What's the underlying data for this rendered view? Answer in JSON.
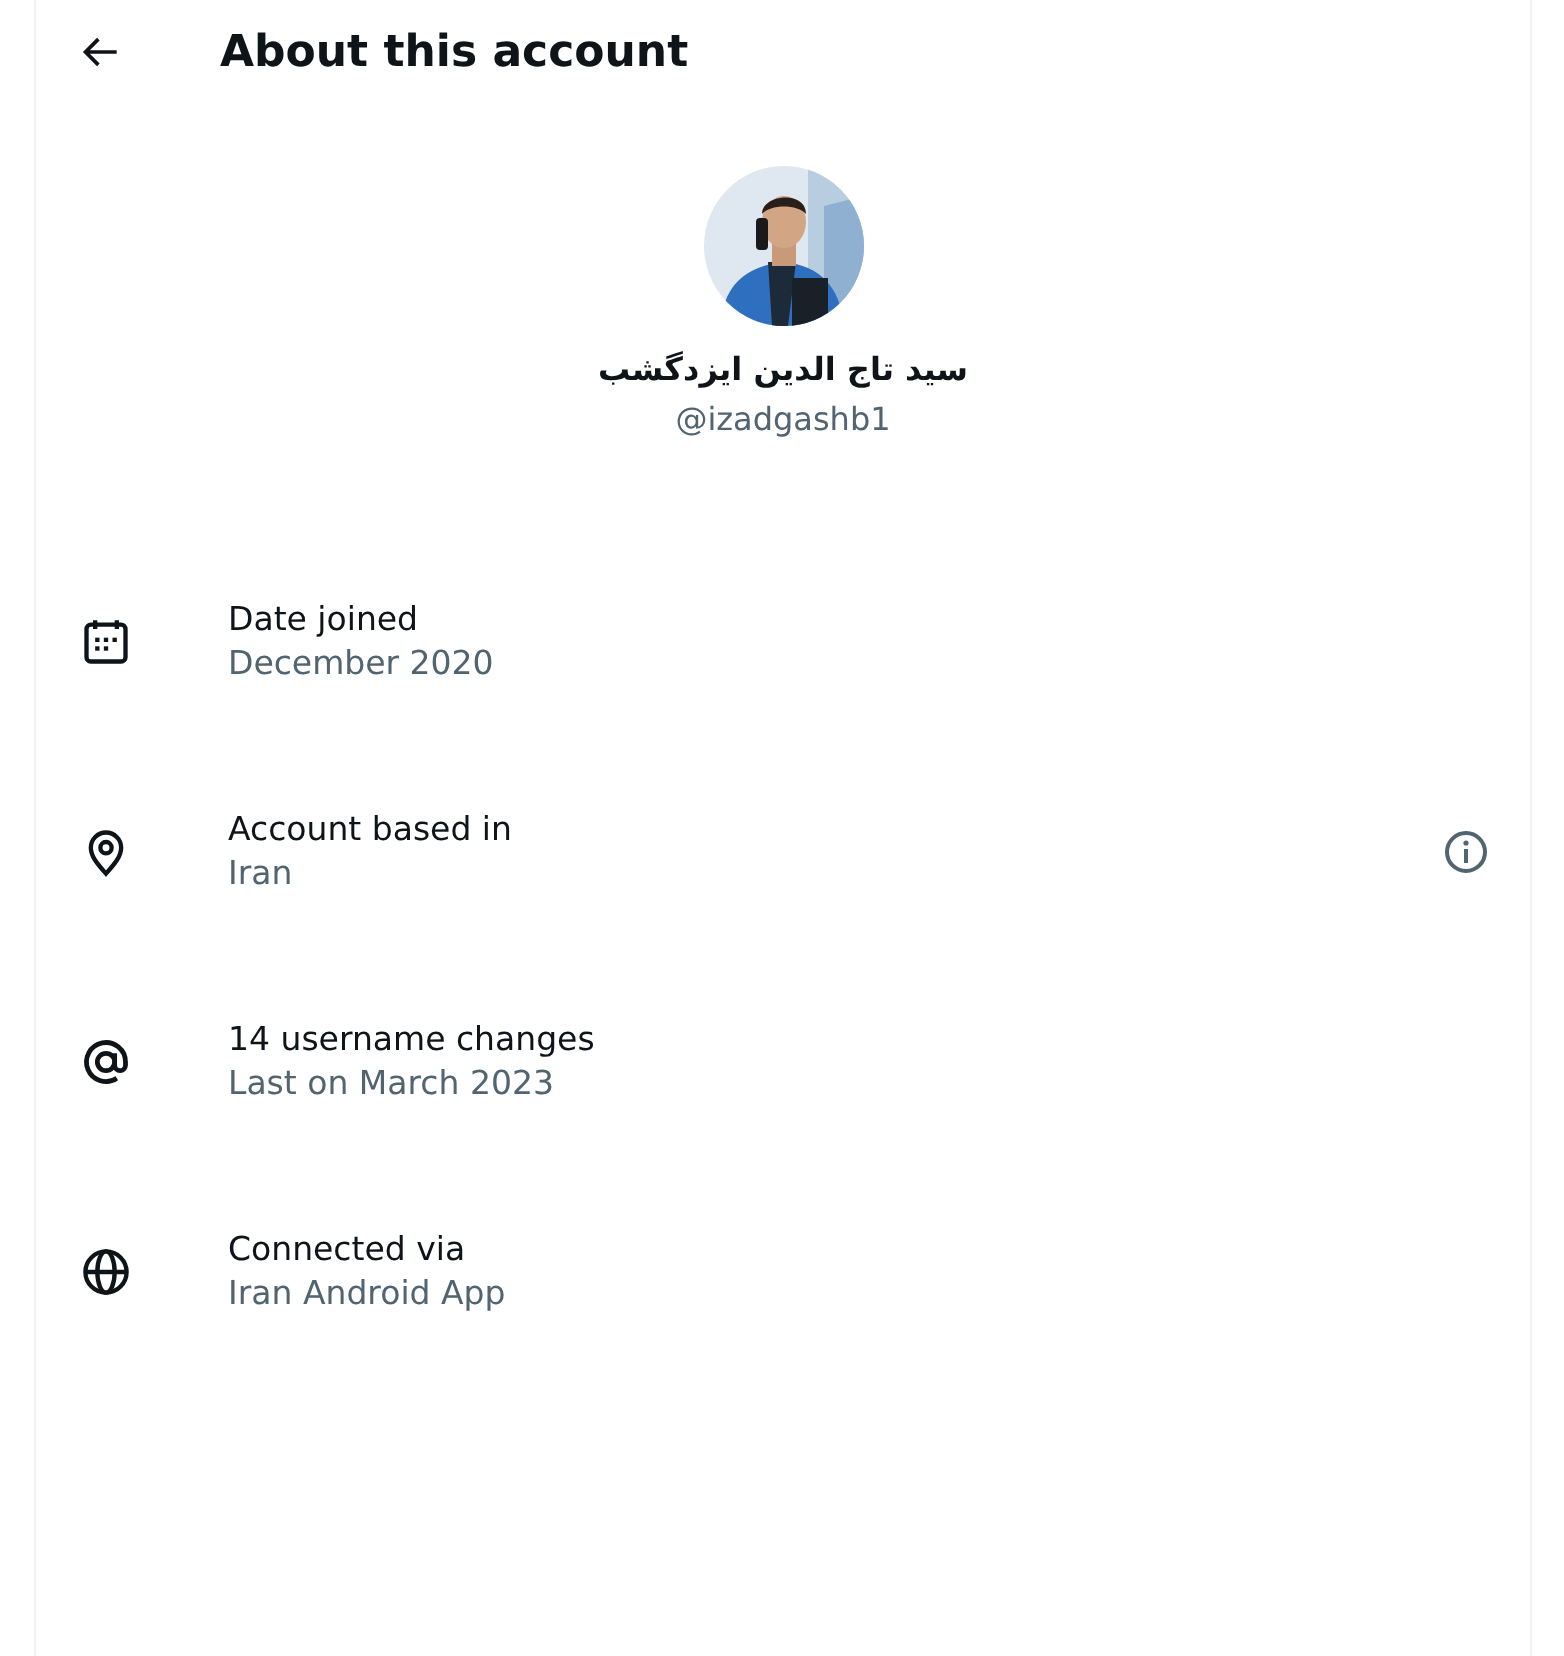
{
  "header": {
    "title": "About this account"
  },
  "profile": {
    "name": "سید تاج الدین ایزدگشب",
    "handle": "@izadgashb1"
  },
  "items": [
    {
      "kind": "calendar",
      "label": "Date joined",
      "value": "December 2020",
      "info": false
    },
    {
      "kind": "location",
      "label": "Account based in",
      "value": "Iran",
      "info": true
    },
    {
      "kind": "at",
      "label": "14 username changes",
      "value": "Last on March 2023",
      "info": false
    },
    {
      "kind": "globe",
      "label": "Connected via",
      "value": "Iran Android App",
      "info": false
    }
  ]
}
